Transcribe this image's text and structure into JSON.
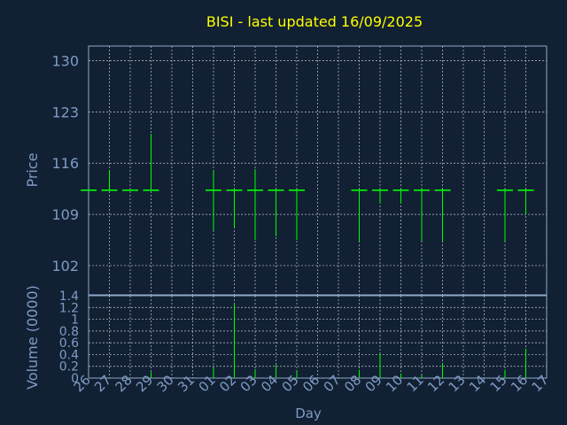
{
  "colors": {
    "background": "#112033",
    "title": "#ffff00",
    "axis_text": "#7f9bc4",
    "frame": "#8fa9c9",
    "grid": "#c0c8d4",
    "series": "#00ff00"
  },
  "chart_data": [
    {
      "type": "ohlc",
      "title": "BISI - last updated 16/09/2025",
      "ylabel": "Price",
      "xlabel": "",
      "ylim": [
        98,
        132
      ],
      "yticks": [
        102,
        109,
        116,
        123,
        130
      ],
      "grid": true,
      "categories": [
        "26",
        "27",
        "28",
        "29",
        "30",
        "31",
        "01",
        "02",
        "03",
        "04",
        "05",
        "06",
        "07",
        "08",
        "09",
        "10",
        "11",
        "12",
        "13",
        "14",
        "15",
        "16",
        "17"
      ],
      "bars": [
        {
          "day": "26",
          "open": 112.3,
          "high": 112.3,
          "low": 112.3,
          "close": 112.3
        },
        {
          "day": "27",
          "open": 112.3,
          "high": 115.0,
          "low": 112.3,
          "close": 112.3
        },
        {
          "day": "28",
          "open": 112.3,
          "high": 112.3,
          "low": 112.3,
          "close": 112.3
        },
        {
          "day": "29",
          "open": 112.3,
          "high": 120.0,
          "low": 112.3,
          "close": 112.3
        },
        {
          "day": "01",
          "open": 112.3,
          "high": 115.0,
          "low": 106.8,
          "close": 112.3
        },
        {
          "day": "02",
          "open": 112.3,
          "high": 112.3,
          "low": 107.2,
          "close": 112.3
        },
        {
          "day": "03",
          "open": 112.3,
          "high": 115.2,
          "low": 105.5,
          "close": 112.3
        },
        {
          "day": "04",
          "open": 112.3,
          "high": 112.3,
          "low": 106.0,
          "close": 112.3
        },
        {
          "day": "05",
          "open": 112.3,
          "high": 112.3,
          "low": 105.5,
          "close": 112.3
        },
        {
          "day": "08",
          "open": 112.3,
          "high": 112.3,
          "low": 105.3,
          "close": 112.3
        },
        {
          "day": "09",
          "open": 112.3,
          "high": 112.3,
          "low": 110.5,
          "close": 112.3
        },
        {
          "day": "10",
          "open": 112.3,
          "high": 112.3,
          "low": 110.5,
          "close": 112.3
        },
        {
          "day": "11",
          "open": 112.3,
          "high": 112.3,
          "low": 105.3,
          "close": 112.3
        },
        {
          "day": "12",
          "open": 112.3,
          "high": 112.3,
          "low": 105.3,
          "close": 112.3
        },
        {
          "day": "15",
          "open": 112.3,
          "high": 112.3,
          "low": 105.3,
          "close": 112.3
        },
        {
          "day": "16",
          "open": 112.3,
          "high": 112.3,
          "low": 109.0,
          "close": 112.3
        }
      ]
    },
    {
      "type": "bar",
      "ylabel": "Volume (0000)",
      "xlabel": "Day",
      "ylim": [
        0,
        1.4
      ],
      "ytick_labels": [
        "0",
        "0.2",
        "0.4",
        "0.6",
        "0.8",
        "1",
        "1.2",
        "1.4"
      ],
      "yticks": [
        0,
        0.2,
        0.4,
        0.6,
        0.8,
        1.0,
        1.2,
        1.4
      ],
      "grid": true,
      "categories": [
        "26",
        "27",
        "28",
        "29",
        "30",
        "31",
        "01",
        "02",
        "03",
        "04",
        "05",
        "06",
        "07",
        "08",
        "09",
        "10",
        "11",
        "12",
        "13",
        "14",
        "15",
        "16",
        "17"
      ],
      "bars": [
        {
          "day": "26",
          "value": 0.01
        },
        {
          "day": "27",
          "value": 0.01
        },
        {
          "day": "28",
          "value": 0.01
        },
        {
          "day": "29",
          "value": 0.1
        },
        {
          "day": "01",
          "value": 0.18
        },
        {
          "day": "02",
          "value": 1.25
        },
        {
          "day": "03",
          "value": 0.15
        },
        {
          "day": "04",
          "value": 0.22
        },
        {
          "day": "05",
          "value": 0.12
        },
        {
          "day": "08",
          "value": 0.14
        },
        {
          "day": "09",
          "value": 0.42
        },
        {
          "day": "10",
          "value": 0.08
        },
        {
          "day": "11",
          "value": 0.06
        },
        {
          "day": "12",
          "value": 0.26
        },
        {
          "day": "15",
          "value": 0.14
        },
        {
          "day": "16",
          "value": 0.5
        }
      ]
    }
  ]
}
